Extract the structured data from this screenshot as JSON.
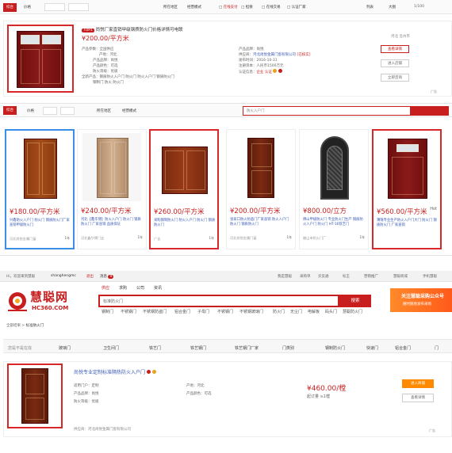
{
  "top_filter": {
    "tab": "综合",
    "sort": "价格",
    "region": "所在地区",
    "mode": "经营模式",
    "checks": [
      "在线支付",
      "担保",
      "在线交易",
      "认证厂家"
    ],
    "list_toggle": "列表",
    "grid_toggle": "大图",
    "page": "1/100"
  },
  "featured": {
    "tag": "TOP1",
    "title": "尚悦厂家直销甲级钢质防火门价格详情可电联",
    "price": "¥200.00/平方米",
    "specs_left": [
      {
        "label": "产品参数",
        "value": "全国供应"
      },
      {
        "label": "产地",
        "value": "河北"
      },
      {
        "label": "产品品牌",
        "value": "尚悦"
      },
      {
        "label": "产品颜色",
        "value": "可选"
      },
      {
        "label": "防火等级",
        "value": "优级"
      }
    ],
    "tags_line": "全新产品：钢质防火入户门 防火门 防火入户门 钢质防火门",
    "tags_line2": "钢制门 防火 防火门",
    "specs_right": [
      {
        "label": "产品品牌",
        "value": "尚悦"
      },
      {
        "label": "供应商",
        "value": "河北尚悦金属门窗有限公司"
      },
      {
        "label": "发布时间",
        "value": "2016-10-31"
      },
      {
        "label": "注册资本",
        "value": "人民币1500万元"
      }
    ],
    "auth_label": "认证信息",
    "auth_value": "企业 认证",
    "location": "河北 沧州市",
    "buttons": [
      "查看详情",
      "进入店铺",
      "立即咨询"
    ],
    "ad": "广告"
  },
  "filter2": {
    "tab": "综合",
    "sort": "价格",
    "region": "所在地区",
    "mode": "经营模式",
    "search_placeholder": "防火入户门"
  },
  "cards": [
    {
      "price": "¥180.00/平方米",
      "title": "兴鑫防火入户门 防火门 钢质防火门厂家直销甲级防火门",
      "company": "河北尚悦金属门窗",
      "badge": "1年"
    },
    {
      "price": "¥240.00/平方米",
      "title": "河北【鑫华博】防火入户门 防火门 钢质防火门 厂家直销 品质保证",
      "company": "河北鑫华博门业",
      "badge": "1年"
    },
    {
      "price": "¥260.00/平方米",
      "title": "采购钢制防火门 防火入户门 防火门 钢质防火门",
      "company": "广告",
      "badge": "1年"
    },
    {
      "price": "¥200.00/平方米",
      "title": "张家口防火防盗门厂家直销 防火入户门 防火门 钢质防火门",
      "company": "河北尚悦金属门窗",
      "badge": "1年"
    },
    {
      "price": "¥800.00/立方",
      "title": "佛山甲级防火门 专业防火门生产 钢质防火入户门 防火门 HT-16铁艺门",
      "company": "佛山市防火门厂",
      "badge": "1年"
    },
    {
      "price": "¥560.00/平方米",
      "title": "薄锦专业生产防火入户门大门 防火门 钢质防火门 厂家直销",
      "company": "",
      "badge": "Hot"
    }
  ],
  "site": {
    "greeting": "Hi，欢迎来到慧聪",
    "username": "shanghengmc",
    "logout": "退出",
    "msg": "消息",
    "msg_count": "9",
    "top_links": [
      "我是慧聪",
      "采购单",
      "买卖通",
      "标王",
      "营销推广",
      "慧聪商城",
      "手机慧聪"
    ],
    "search_tabs": [
      "供应",
      "求购",
      "公司",
      "资讯"
    ],
    "search_value": "标准防火门",
    "search_btn": "搜索",
    "logo_cn": "慧聪网",
    "logo_en": "HC360.COM",
    "hot_words": [
      "钢制门",
      "不锈钢门",
      "不锈钢防盗门",
      "铝合金门",
      "子母门",
      "不锈钢门",
      "不锈钢玻璃门",
      "防火门",
      "无尘门",
      "电解板",
      "码头门",
      "慧聪防火门"
    ],
    "ad_text": "关注慧聪采购公众号",
    "ad_sub": "随时随地发布采购"
  },
  "breadcrumb": [
    "全部结果",
    "标准防火门"
  ],
  "filter_row": {
    "label": "您是不是在找",
    "items": [
      "玻璃门",
      "卫生间门",
      "铁艺门",
      "铁艺钢门",
      "铁艺钢门厂家",
      "门类别",
      "钢制防火门",
      "快速门",
      "铝合金门",
      "门"
    ]
  },
  "product": {
    "title": "尚悦专业定制标准隔热防火入户门",
    "rows": [
      {
        "label": "适用门户",
        "value": "定制"
      },
      {
        "label": "产品品牌",
        "value": "尚悦"
      },
      {
        "label": "防火等级",
        "value": "优级"
      }
    ],
    "rows_right": [
      {
        "label": "产地",
        "value": "河北"
      },
      {
        "label": "产品颜色",
        "value": "可选"
      }
    ],
    "price": "¥460.00/樘",
    "moq": "起订量 ≥1樘",
    "buttons": [
      "进入商铺",
      "查看详情"
    ],
    "supplier": "供应商：河北尚悦金属门窗有限公司",
    "ad": "广告"
  }
}
